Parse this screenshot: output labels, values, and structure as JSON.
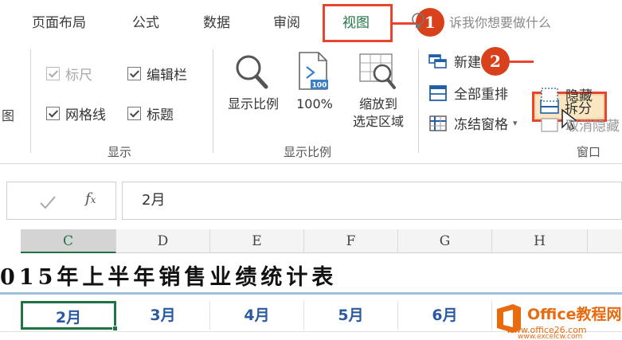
{
  "tabs": [
    {
      "label": "页面布局"
    },
    {
      "label": "公式"
    },
    {
      "label": "数据"
    },
    {
      "label": "审阅"
    },
    {
      "label": "视图",
      "active": true
    }
  ],
  "tell_me": "诉我你想要做什么",
  "callouts": [
    "1",
    "2"
  ],
  "ribbon": {
    "left_fragment": "图",
    "show": {
      "label": "显示",
      "ruler": {
        "label": "标尺",
        "checked": true,
        "enabled": false
      },
      "formula_bar": {
        "label": "编辑栏",
        "checked": true,
        "enabled": true
      },
      "gridlines": {
        "label": "网格线",
        "checked": true,
        "enabled": true
      },
      "headings": {
        "label": "标题",
        "checked": true,
        "enabled": true
      }
    },
    "zoom": {
      "label": "显示比例",
      "zoom_button": "显示比例",
      "hundred": "100%",
      "hundred_icon_text": "100",
      "zoom_selection_line1": "缩放到",
      "zoom_selection_line2": "选定区域"
    },
    "window": {
      "label": "窗口",
      "new_window": "新建",
      "arrange_all": "全部重排",
      "freeze_panes": "冻结窗格",
      "split": "拆分",
      "hide": "隐藏",
      "unhide": "取消隐藏"
    }
  },
  "formula_bar": {
    "value": "2月"
  },
  "sheet": {
    "columns": [
      "C",
      "D",
      "E",
      "F",
      "G",
      "H"
    ],
    "selected_column": "C",
    "title": "015年上半年销售业绩统计表",
    "row_values": [
      "2月",
      "3月",
      "4月",
      "5月",
      "6月"
    ]
  },
  "watermark": {
    "brand": "Office教程网",
    "url": "www.office26.com",
    "url2": "www.excelcw.com"
  },
  "colors": {
    "accent_green": "#217346",
    "callout_red": "#e8442e",
    "cell_blue": "#2c5aa0",
    "watermark_orange": "#e96b10"
  }
}
